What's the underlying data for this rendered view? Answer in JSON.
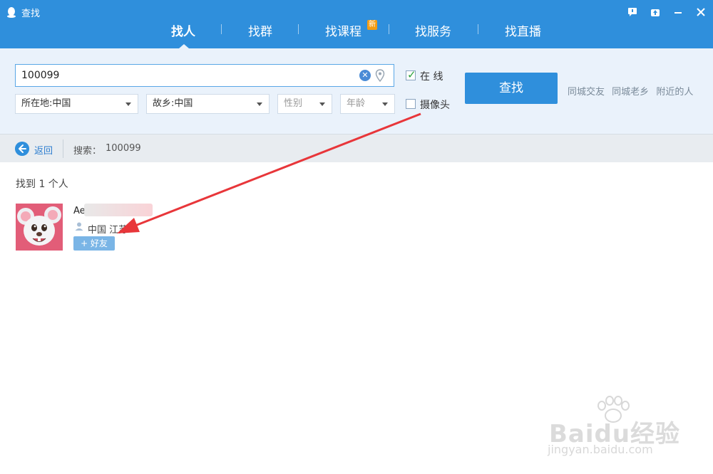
{
  "window": {
    "title": "查找",
    "controls": [
      "feedback-icon",
      "upload-icon",
      "minimize-icon",
      "close-icon"
    ]
  },
  "tabs": [
    {
      "label": "找人",
      "active": true
    },
    {
      "label": "找群",
      "active": false
    },
    {
      "label": "找课程",
      "active": false,
      "badge": "新"
    },
    {
      "label": "找服务",
      "active": false
    },
    {
      "label": "找直播",
      "active": false
    }
  ],
  "search": {
    "value": "100099",
    "filters": {
      "location": "所在地:中国",
      "hometown": "故乡:中国",
      "gender_placeholder": "性别",
      "age_placeholder": "年龄"
    },
    "online_label": "在  线",
    "online_checked": true,
    "camera_label": "摄像头",
    "camera_checked": false,
    "find_button": "查找",
    "quick_links": [
      "同城交友",
      "同城老乡",
      "附近的人"
    ]
  },
  "breadcrumb": {
    "back_label": "返回",
    "search_label": "搜索：",
    "search_value": "100099"
  },
  "results": {
    "count_text": "找到 1 个人",
    "items": [
      {
        "name": "Ae",
        "location": "中国 江苏",
        "add_button": "+ 好友"
      }
    ]
  },
  "watermark": {
    "brand": "Baidu经验",
    "url": "jingyan.baidu.com"
  },
  "colors": {
    "accent": "#2f8fdc",
    "annotation_arrow": "#e8363a"
  }
}
